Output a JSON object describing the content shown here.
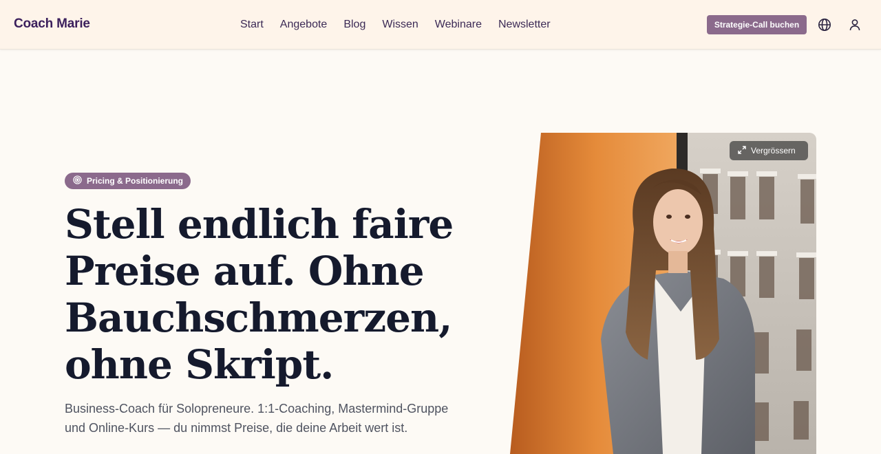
{
  "header": {
    "brand": "Coach Marie",
    "nav": [
      "Start",
      "Angebote",
      "Blog",
      "Wissen",
      "Webinare",
      "Newsletter"
    ],
    "cta_label": "Strategie-Call buchen",
    "icons": [
      "globe-icon",
      "user-icon"
    ]
  },
  "hero": {
    "badge_label": "Pricing & Positionierung",
    "badge_icon": "target-icon",
    "headline": "Stell endlich faire Preise auf. Ohne Bauchschmerzen, ohne Skript.",
    "subtitle": "Business-Coach für Solopreneure. 1:1-Coaching, Mastermind-Gruppe und Online-Kurs — du nimmst Preise, die deine Arbeit wert ist.",
    "image_button_label": "Vergrössern",
    "image_button_icon": "expand-icon"
  },
  "colors": {
    "header_bg": "#fef4ea",
    "page_bg": "#fdfaf5",
    "accent": "#8b6a8c",
    "brand_text": "#3b1f5c",
    "headline_text": "#151a2d"
  }
}
